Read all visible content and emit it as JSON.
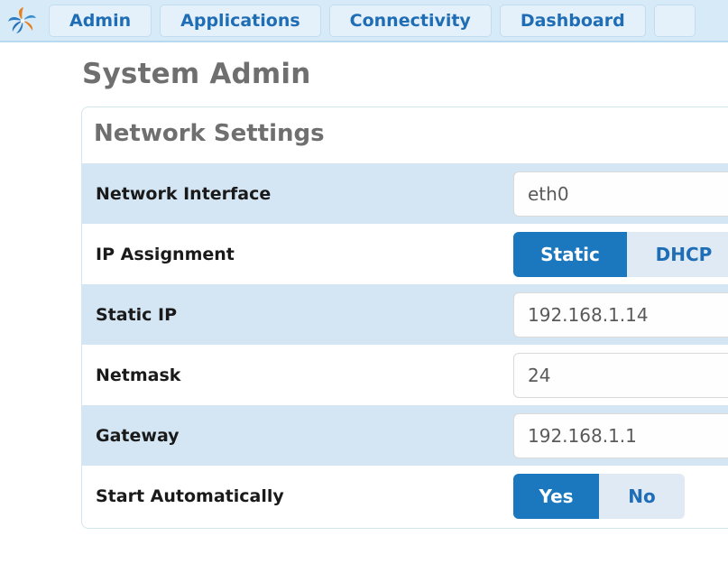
{
  "navbar": {
    "logo_icon": "pinwheel-logo-icon",
    "items": [
      {
        "label": "Admin"
      },
      {
        "label": "Applications"
      },
      {
        "label": "Connectivity"
      },
      {
        "label": "Dashboard"
      },
      {
        "label": ""
      }
    ]
  },
  "page": {
    "title": "System Admin"
  },
  "panel": {
    "header": "Network Settings",
    "rows": [
      {
        "label": "Network Interface",
        "control": "text",
        "value": "eth0",
        "placeholder": ""
      },
      {
        "label": "IP Assignment",
        "control": "toggle",
        "options": [
          "Static",
          "DHCP"
        ],
        "selected": "Static"
      },
      {
        "label": "Static IP",
        "control": "text",
        "value": "192.168.1.14",
        "placeholder": ""
      },
      {
        "label": "Netmask",
        "control": "text",
        "value": "24",
        "placeholder": ""
      },
      {
        "label": "Gateway",
        "control": "text",
        "value": "192.168.1.1",
        "placeholder": ""
      },
      {
        "label": "Start Automatically",
        "control": "toggle",
        "options": [
          "Yes",
          "No"
        ],
        "selected": "Yes"
      }
    ]
  },
  "colors": {
    "nav_background": "#d6eaf8",
    "nav_button": "#e4f1fb",
    "accent_blue": "#1b78be",
    "link_blue": "#1f6db5",
    "row_stripe": "#d4e6f4",
    "title_gray": "#6f6f6f",
    "logo_orange": "#e8801e",
    "logo_blue": "#1f6db5"
  }
}
